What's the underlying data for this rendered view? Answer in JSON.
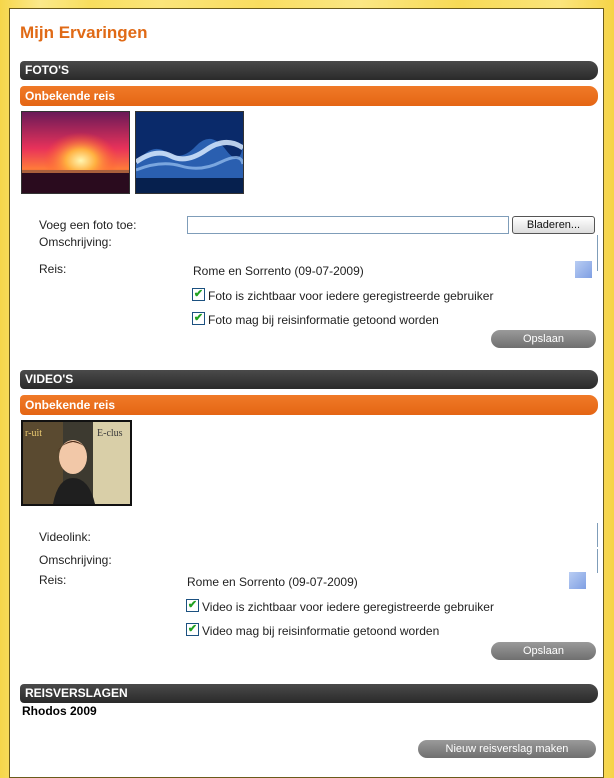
{
  "page": {
    "title": "Mijn Ervaringen"
  },
  "fotos": {
    "header": "FOTO'S",
    "group": "Onbekende reis",
    "add_label": "Voeg een foto toe:",
    "browse_label": "Bladeren...",
    "desc_label": "Omschrijving:",
    "trip_label": "Reis:",
    "trip_value": "Rome en Sorrento (09-07-2009)",
    "check1": "Foto is zichtbaar voor iedere geregistreerde gebruiker",
    "check2": "Foto mag bij reisinformatie getoond worden",
    "save": "Opslaan"
  },
  "videos": {
    "header": "VIDEO'S",
    "group": "Onbekende reis",
    "link_label": "Videolink:",
    "desc_label": "Omschrijving:",
    "trip_label": "Reis:",
    "trip_value": "Rome en Sorrento (09-07-2009)",
    "check1": "Video is zichtbaar voor iedere geregistreerde gebruiker",
    "check2": "Video mag bij reisinformatie getoond worden",
    "save": "Opslaan"
  },
  "reisverslagen": {
    "header": "REISVERSLAGEN",
    "item": "Rhodos 2009",
    "new_button": "Nieuw reisverslag maken"
  },
  "icons": {
    "check": "checkmark-icon",
    "picker": "trip-picker-icon"
  },
  "colors": {
    "accent": "#e06a16",
    "bar_dark": "#2f2f2f",
    "bar_orange": "#ec7020"
  }
}
